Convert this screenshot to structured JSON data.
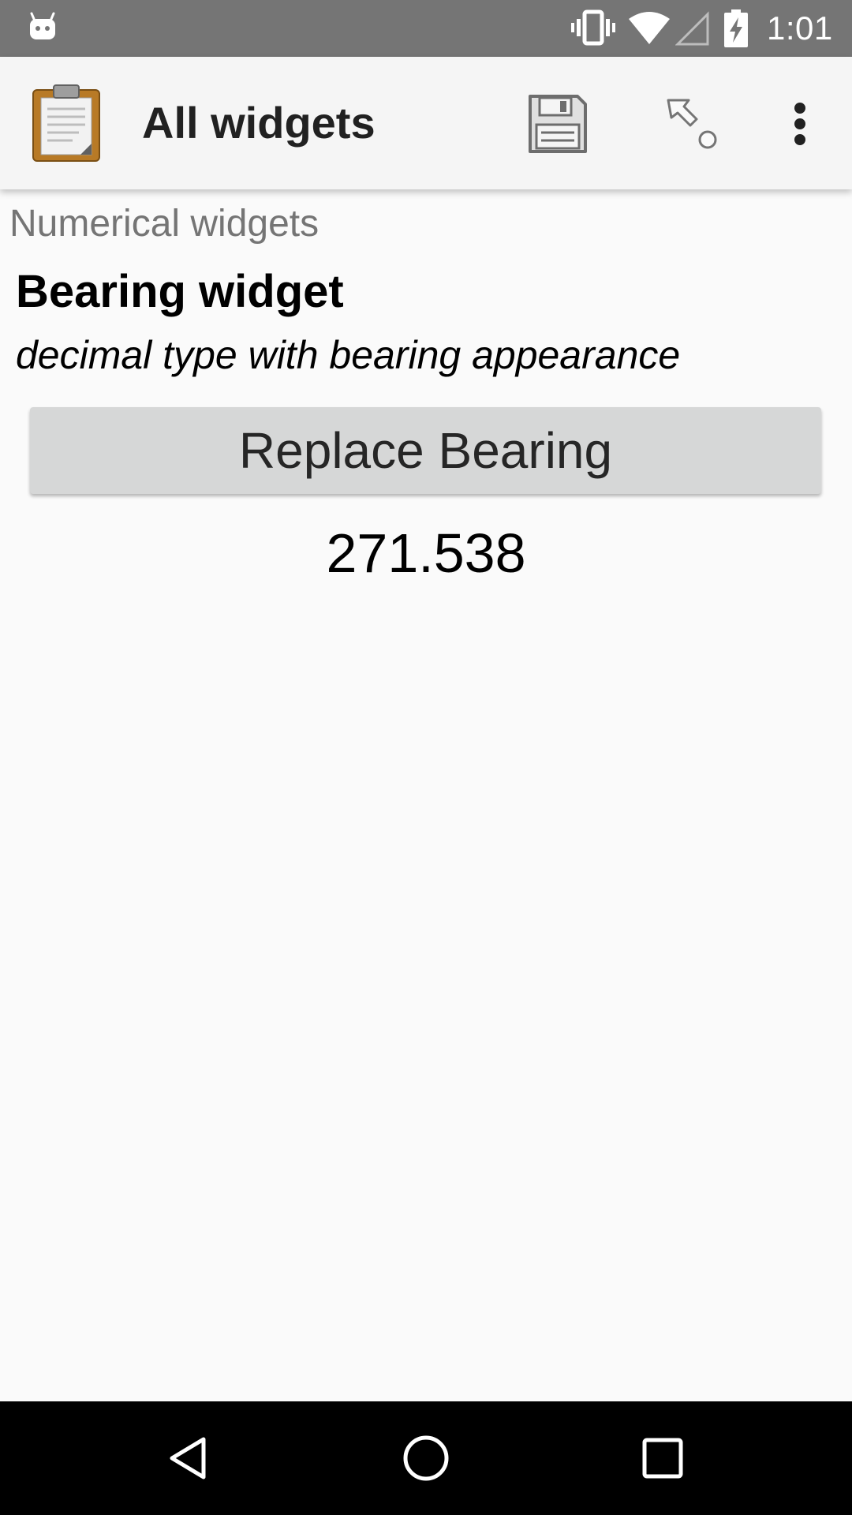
{
  "status_bar": {
    "time": "1:01",
    "icons": [
      "android-notification-icon",
      "vibrate-icon",
      "wifi-icon",
      "cell-signal-icon",
      "battery-charging-icon"
    ]
  },
  "app_bar": {
    "title": "All widgets",
    "app_icon": "clipboard-icon",
    "actions": [
      "save-icon",
      "goto-question-icon",
      "overflow-menu-icon"
    ]
  },
  "form": {
    "group_label": "Numerical widgets",
    "question_label": "Bearing widget",
    "question_hint": "decimal type with bearing appearance",
    "replace_button_label": "Replace Bearing",
    "bearing_value": "271.538"
  },
  "nav_bar": {
    "buttons": [
      "back-icon",
      "home-icon",
      "recents-icon"
    ]
  },
  "colors": {
    "status_bar": "#757575",
    "app_bar": "#f5f5f5",
    "background": "#fafafa",
    "button": "#d6d7d7",
    "nav_bar": "#000000"
  }
}
